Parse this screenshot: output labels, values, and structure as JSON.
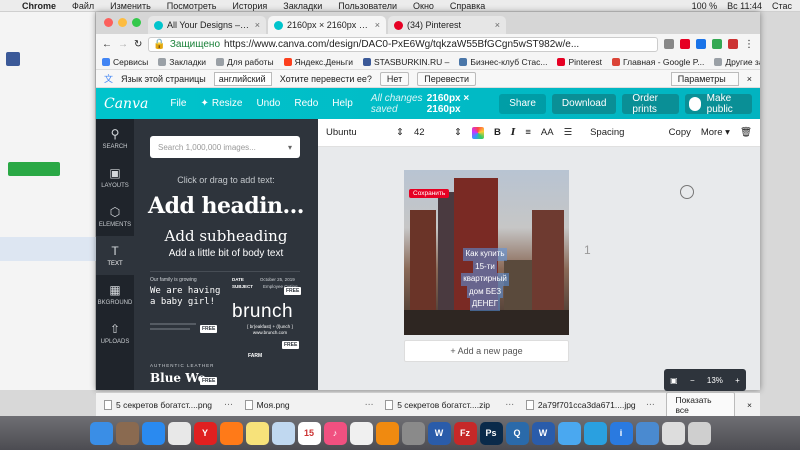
{
  "menubar": {
    "items": [
      "Chrome",
      "Файл",
      "Изменить",
      "Посмотреть",
      "История",
      "Закладки",
      "Пользователи",
      "Окно",
      "Справка"
    ],
    "battery": "100 %",
    "clock": "Вс 11:44",
    "user": "Стас"
  },
  "tabs": [
    {
      "label": "All Your Designs – Canva",
      "color": "#00c4cc"
    },
    {
      "label": "2160px × 2160px – Untitled D...",
      "color": "#00c4cc"
    },
    {
      "label": "(34) Pinterest",
      "color": "#e60023"
    }
  ],
  "address": {
    "secure": "Защищено",
    "url": "https://www.canva.com/design/DAC0-PxE6Wg/tqkzaW55BfGCgn5wST982w/e..."
  },
  "bookmarks": [
    {
      "label": "Сервисы",
      "color": "#4285f4"
    },
    {
      "label": "Закладки",
      "color": "#9aa0a6"
    },
    {
      "label": "Для работы",
      "color": "#9aa0a6"
    },
    {
      "label": "Яндекс.Деньги",
      "color": "#fc3f1d"
    },
    {
      "label": "STASBURKIN.RU – ",
      "color": "#3b5998"
    },
    {
      "label": "Бизнес-клуб Стас...",
      "color": "#4a76a8"
    },
    {
      "label": "Pinterest",
      "color": "#e60023"
    },
    {
      "label": "Главная - Google P...",
      "color": "#db4437"
    }
  ],
  "bookmarks_other": "Другие закладки",
  "translate_bar": {
    "question": "Язык этой страницы",
    "language": "английский",
    "prompt": "Хотите перевести ее?",
    "no": "Нет",
    "translate": "Перевести",
    "params": "Параметры"
  },
  "canva": {
    "logo": "Canva",
    "nav": [
      "File",
      "Resize",
      "Undo",
      "Redo",
      "Help"
    ],
    "saved": "All changes saved",
    "dims": "2160px × 2160px",
    "share": "Share",
    "download": "Download",
    "order": "Order prints",
    "public": "Make public"
  },
  "rail": [
    {
      "label": "SEARCH",
      "icon": "search-icon",
      "glyph": "⚲"
    },
    {
      "label": "LAYOUTS",
      "icon": "layouts-icon",
      "glyph": "▣"
    },
    {
      "label": "ELEMENTS",
      "icon": "elements-icon",
      "glyph": "⬡"
    },
    {
      "label": "TEXT",
      "icon": "text-icon",
      "glyph": "T"
    },
    {
      "label": "BKGROUND",
      "icon": "background-icon",
      "glyph": "▦"
    },
    {
      "label": "UPLOADS",
      "icon": "uploads-icon",
      "glyph": "⇧"
    }
  ],
  "panel": {
    "search_placeholder": "Search 1,000,000 images...",
    "hint": "Click or drag to add text:",
    "heading": "Add headin...",
    "subheading": "Add subheading",
    "body": "Add a little bit of body text",
    "templates": {
      "girl_small": "Our family is growing",
      "girl": "We are having a baby girl!",
      "brunch_date": "DATE",
      "brunch_subject": "SUBJECT",
      "brunch_date_val": "October 25, 2019",
      "brunch_subject_val": "Employee Outing",
      "brunch": "brunch",
      "brunch_sub": "[ br(eakfast) + (l)unch ]",
      "brunch_url": "www.brunch.com",
      "leather": "AUTHENTIC LEATHER",
      "bluewo": "Blue Wo",
      "farm": "FARM",
      "free": "FREE"
    }
  },
  "toolbar": {
    "font": "Ubuntu",
    "size": "42",
    "bold": "B",
    "italic": "I",
    "case": "AA",
    "spacing": "Spacing",
    "copy": "Copy",
    "more": "More"
  },
  "design": {
    "pin_save": "Сохранить",
    "text_lines": [
      "Как купить",
      "15-ти",
      "квартирный",
      "дом БЕЗ",
      "ДЕНЕГ"
    ]
  },
  "add_page": "+ Add a new page",
  "page_number": "1",
  "zoom": "13%",
  "downloads": [
    "5 секретов богатст....png",
    "Моя.png",
    "5 секретов богатст....zip",
    "2a79f701cca3da671....jpg"
  ],
  "show_all": "Показать все",
  "dock": [
    {
      "name": "finder",
      "color": "#3a8ee6",
      "glyph": ""
    },
    {
      "name": "launchpad",
      "color": "#8a6a50",
      "glyph": ""
    },
    {
      "name": "safari",
      "color": "#2a8af0",
      "glyph": ""
    },
    {
      "name": "chrome",
      "color": "#e8e8e8",
      "glyph": ""
    },
    {
      "name": "yandex",
      "color": "#e02020",
      "glyph": "Y"
    },
    {
      "name": "firefox",
      "color": "#ff7a18",
      "glyph": ""
    },
    {
      "name": "notes",
      "color": "#f7e27a",
      "glyph": ""
    },
    {
      "name": "preview",
      "color": "#c0d8f0",
      "glyph": ""
    },
    {
      "name": "calendar",
      "color": "#ffffff",
      "glyph": "15"
    },
    {
      "name": "music",
      "color": "#f05080",
      "glyph": "♪"
    },
    {
      "name": "photos",
      "color": "#f0f0f0",
      "glyph": ""
    },
    {
      "name": "vlc",
      "color": "#f08a10",
      "glyph": ""
    },
    {
      "name": "prefs",
      "color": "#8a8a8a",
      "glyph": ""
    },
    {
      "name": "word",
      "color": "#2a5caa",
      "glyph": "W"
    },
    {
      "name": "filezilla",
      "color": "#c62828",
      "glyph": "Fz"
    },
    {
      "name": "photoshop",
      "color": "#0a2a4a",
      "glyph": "Ps"
    },
    {
      "name": "quicktime",
      "color": "#2a6aaa",
      "glyph": "Q"
    },
    {
      "name": "word2",
      "color": "#2a5caa",
      "glyph": "W"
    },
    {
      "name": "mail",
      "color": "#4aa8f0",
      "glyph": ""
    },
    {
      "name": "telegram",
      "color": "#2aa0e0",
      "glyph": ""
    },
    {
      "name": "info",
      "color": "#2a7ae0",
      "glyph": "i"
    },
    {
      "name": "files",
      "color": "#4a8ad0",
      "glyph": ""
    },
    {
      "name": "text",
      "color": "#dddddd",
      "glyph": ""
    },
    {
      "name": "trash",
      "color": "#cfcfcf",
      "glyph": ""
    }
  ],
  "colors": {
    "canva_teal": "#00c4cc",
    "panel": "#2e343c",
    "rail": "#1f242b"
  }
}
